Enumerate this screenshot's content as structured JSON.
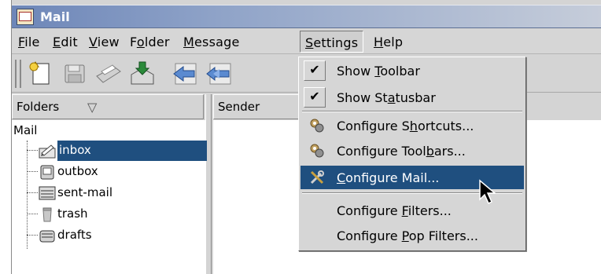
{
  "window": {
    "title": "Mail"
  },
  "menubar": {
    "items": [
      {
        "label": "File",
        "mnemonic": "F",
        "rest": "ile"
      },
      {
        "label": "Edit",
        "mnemonic": "E",
        "rest": "dit"
      },
      {
        "label": "View",
        "mnemonic": "V",
        "rest": "iew"
      },
      {
        "pre": "F",
        "mnemonic": "o",
        "rest": "lder",
        "label": "Folder"
      },
      {
        "label": "Message",
        "mnemonic": "M",
        "rest": "essage"
      },
      {
        "label": "Settings",
        "mnemonic": "S",
        "rest": "ettings"
      },
      {
        "label": "Help",
        "mnemonic": "H",
        "rest": "elp"
      }
    ]
  },
  "toolbar": {
    "buttons": [
      "new-message-icon",
      "save-icon",
      "print-icon",
      "get-mail-icon",
      "reply-icon",
      "reply-all-icon"
    ]
  },
  "folders_panel": {
    "header": "Folders",
    "sort_indicator": "▽",
    "root": "Mail",
    "items": [
      {
        "label": "inbox",
        "icon": "inbox-icon",
        "selected": true
      },
      {
        "label": "outbox",
        "icon": "outbox-icon",
        "selected": false
      },
      {
        "label": "sent-mail",
        "icon": "sent-mail-icon",
        "selected": false
      },
      {
        "label": "trash",
        "icon": "trash-icon",
        "selected": false
      },
      {
        "label": "drafts",
        "icon": "drafts-icon",
        "selected": false
      }
    ]
  },
  "message_list": {
    "sender_header": "Sender"
  },
  "settings_menu": {
    "items": [
      {
        "pre": "Show ",
        "mnemonic": "T",
        "post": "oolbar",
        "checked": true
      },
      {
        "pre": "Show St",
        "mnemonic": "a",
        "post": "tusbar",
        "checked": true
      },
      {
        "pre": "Configure S",
        "mnemonic": "h",
        "post": "ortcuts...",
        "icon": "configure-icon"
      },
      {
        "pre": "Configure Tool",
        "mnemonic": "b",
        "post": "ars...",
        "icon": "configure-icon"
      },
      {
        "pre": "",
        "mnemonic": "C",
        "post": "onfigure Mail...",
        "icon": "tools-icon",
        "highlighted": true
      },
      {
        "pre": "Configure ",
        "mnemonic": "F",
        "post": "ilters..."
      },
      {
        "pre": "Configure ",
        "mnemonic": "P",
        "post": "op Filters..."
      }
    ]
  },
  "colors": {
    "selection": "#1f4f7f",
    "titlebar": "#6d86b8"
  }
}
